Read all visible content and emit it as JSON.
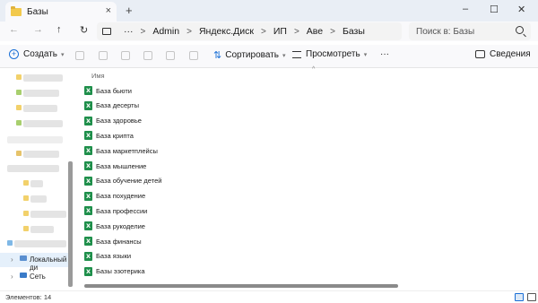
{
  "tab": {
    "title": "Базы",
    "close": "×",
    "new": "+"
  },
  "window_controls": {
    "minimize": "–",
    "maximize": "☐",
    "close": "✕"
  },
  "nav": {
    "back": "←",
    "forward": "→",
    "up": "↑",
    "refresh": "↻"
  },
  "breadcrumbs": {
    "more": "···",
    "items": [
      "Admin",
      "Яндекс.Диск",
      "ИП",
      "Аве",
      "Базы"
    ],
    "sep": ">"
  },
  "search": {
    "placeholder": "Поиск в: Базы"
  },
  "commands": {
    "create": "Создать",
    "sort": "Сортировать",
    "view": "Просмотреть",
    "more": "···",
    "details": "Сведения"
  },
  "sidebar": {
    "local_disk": "Локальный ди",
    "network": "Сеть",
    "expand": "›"
  },
  "list": {
    "column_name": "Имя",
    "sort_caret": "^",
    "file_icon": "X",
    "files": [
      "База бьюти",
      "База десерты",
      "База здоровье",
      "База крипта",
      "База маркетплейсы",
      "База мышление",
      "База обучение детей",
      "База похудение",
      "База профессии",
      "База рукоделие",
      "База финансы",
      "База языки",
      "Базы эзотерика"
    ]
  },
  "status": {
    "text": "Элементов: 14"
  },
  "colors": {
    "accent": "#1a6fd6",
    "excel": "#1f8f4b",
    "folder": "#f2c94c"
  }
}
